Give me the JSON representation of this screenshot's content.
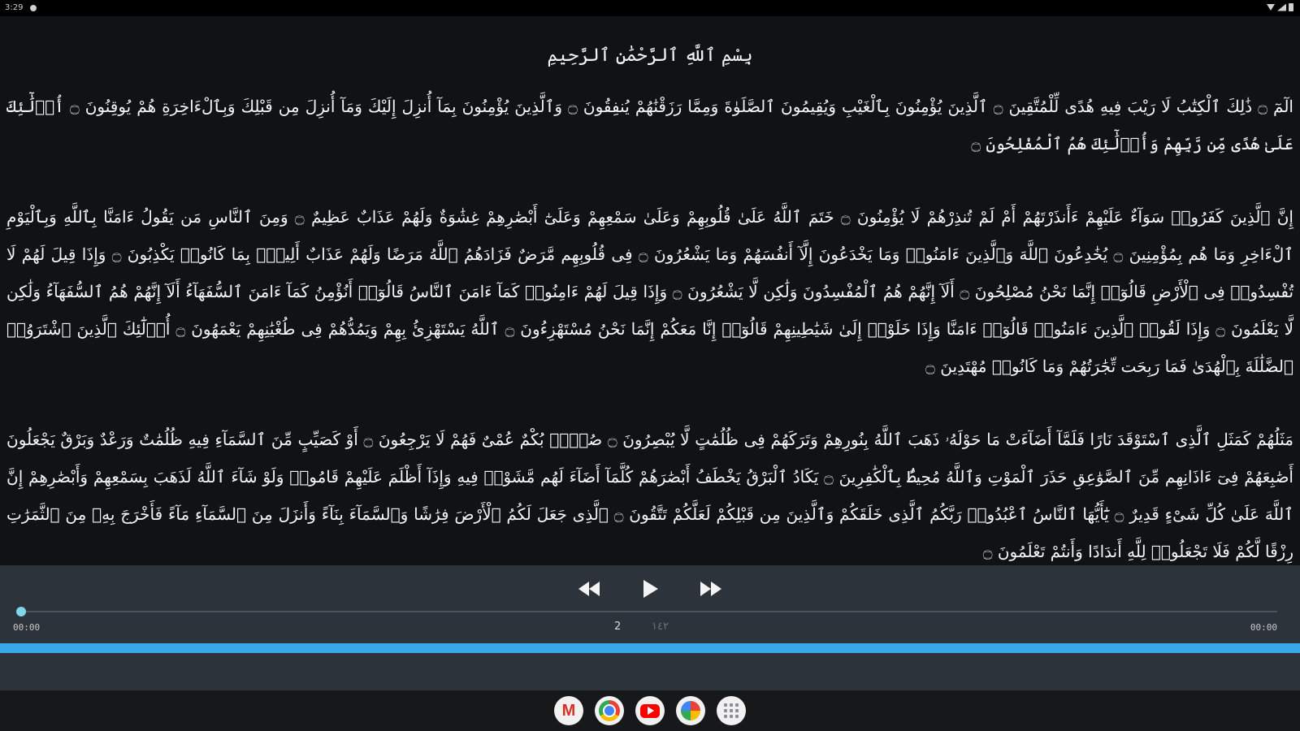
{
  "status_bar": {
    "time": "3:29"
  },
  "reader": {
    "bismillah": "بِسْمِ ٱللَّهِ ٱلرَّحْمَٰنِ ٱلرَّحِيمِ",
    "blocks": [
      "الٓمٓ ۝ ذَٰلِكَ ٱلْكِتَٰبُ لَا رَيْبَ فِيهِ هُدًى لِّلْمُتَّقِينَ ۝ ٱلَّذِينَ يُؤْمِنُونَ بِٱلْغَيْبِ وَيُقِيمُونَ ٱلصَّلَوٰةَ وَمِمَّا رَزَقْنَٰهُمْ يُنفِقُونَ ۝ وَٱلَّذِينَ يُؤْمِنُونَ بِمَآ أُنزِلَ إِلَيْكَ وَمَآ أُنزِلَ مِن قَبْلِكَ وَبِٱلْءَاخِرَةِ هُمْ يُوقِنُونَ ۝ أُو۟لَٰٓئِكَ عَلَىٰ هُدًى مِّن رَّبِّهِمْ وَأُو۟لَٰٓئِكَ هُمُ ٱلْمُفْلِحُونَ ۝",
      "إِنَّ ٱلَّذِينَ كَفَرُوا۟ سَوَآءٌ عَلَيْهِمْ ءَأَنذَرْتَهُمْ أَمْ لَمْ تُنذِرْهُمْ لَا يُؤْمِنُونَ ۝ خَتَمَ ٱللَّهُ عَلَىٰ قُلُوبِهِمْ وَعَلَىٰ سَمْعِهِمْ وَعَلَىٰٓ أَبْصَٰرِهِمْ غِشَٰوَةٌ وَلَهُمْ عَذَابٌ عَظِيمٌ ۝ وَمِنَ ٱلنَّاسِ مَن يَقُولُ ءَامَنَّا بِٱللَّهِ وَبِٱلْيَوْمِ ٱلْءَاخِرِ وَمَا هُم بِمُؤْمِنِينَ ۝ يُخَٰدِعُونَ ٱللَّهَ وَٱلَّذِينَ ءَامَنُوا۟ وَمَا يَخْدَعُونَ إِلَّآ أَنفُسَهُمْ وَمَا يَشْعُرُونَ ۝ فِى قُلُوبِهِم مَّرَضٌ فَزَادَهُمُ ٱللَّهُ مَرَضًا وَلَهُمْ عَذَابٌ أَلِيمٌۢ بِمَا كَانُوا۟ يَكْذِبُونَ ۝ وَإِذَا قِيلَ لَهُمْ لَا تُفْسِدُوا۟ فِى ٱلْأَرْضِ قَالُوٓا۟ إِنَّمَا نَحْنُ مُصْلِحُونَ ۝ أَلَآ إِنَّهُمْ هُمُ ٱلْمُفْسِدُونَ وَلَٰكِن لَّا يَشْعُرُونَ ۝ وَإِذَا قِيلَ لَهُمْ ءَامِنُوا۟ كَمَآ ءَامَنَ ٱلنَّاسُ قَالُوٓا۟ أَنُؤْمِنُ كَمَآ ءَامَنَ ٱلسُّفَهَآءُ أَلَآ إِنَّهُمْ هُمُ ٱلسُّفَهَآءُ وَلَٰكِن لَّا يَعْلَمُونَ ۝ وَإِذَا لَقُوا۟ ٱلَّذِينَ ءَامَنُوا۟ قَالُوٓا۟ ءَامَنَّا وَإِذَا خَلَوْا۟ إِلَىٰ شَيَٰطِينِهِمْ قَالُوٓا۟ إِنَّا مَعَكُمْ إِنَّمَا نَحْنُ مُسْتَهْزِءُونَ ۝ ٱللَّهُ يَسْتَهْزِئُ بِهِمْ وَيَمُدُّهُمْ فِى طُغْيَٰنِهِمْ يَعْمَهُونَ ۝ أُو۟لَٰٓئِكَ ٱلَّذِينَ ٱشْتَرَوُا۟ ٱلضَّلَٰلَةَ بِٱلْهُدَىٰ فَمَا رَبِحَت تِّجَٰرَتُهُمْ وَمَا كَانُوا۟ مُهْتَدِينَ ۝",
      "مَثَلُهُمْ كَمَثَلِ ٱلَّذِى ٱسْتَوْقَدَ نَارًا فَلَمَّآ أَضَآءَتْ مَا حَوْلَهُۥ ذَهَبَ ٱللَّهُ بِنُورِهِمْ وَتَرَكَهُمْ فِى ظُلُمَٰتٍ لَّا يُبْصِرُونَ ۝ صُمٌّۢ بُكْمٌ عُمْىٌ فَهُمْ لَا يَرْجِعُونَ ۝ أَوْ كَصَيِّبٍ مِّنَ ٱلسَّمَآءِ فِيهِ ظُلُمَٰتٌ وَرَعْدٌ وَبَرْقٌ يَجْعَلُونَ أَصَٰبِعَهُمْ فِىٓ ءَاذَانِهِم مِّنَ ٱلصَّوَٰعِقِ حَذَرَ ٱلْمَوْتِ وَٱللَّهُ مُحِيطٌۢ بِٱلْكَٰفِرِينَ ۝ يَكَادُ ٱلْبَرْقُ يَخْطَفُ أَبْصَٰرَهُمْ كُلَّمَآ أَضَآءَ لَهُم مَّشَوْا۟ فِيهِ وَإِذَآ أَظْلَمَ عَلَيْهِمْ قَامُوا۟ وَلَوْ شَآءَ ٱللَّهُ لَذَهَبَ بِسَمْعِهِمْ وَأَبْصَٰرِهِمْ إِنَّ ٱللَّهَ عَلَىٰ كُلِّ شَىْءٍ قَدِيرٌ ۝ يَٰٓأَيُّهَا ٱلنَّاسُ ٱعْبُدُوا۟ رَبَّكُمُ ٱلَّذِى خَلَقَكُمْ وَٱلَّذِينَ مِن قَبْلِكُمْ لَعَلَّكُمْ تَتَّقُونَ ۝ ٱلَّذِى جَعَلَ لَكُمُ ٱلْأَرْضَ فِرَٰشًا وَٱلسَّمَآءَ بِنَآءً وَأَنزَلَ مِنَ ٱلسَّمَآءِ مَآءً فَأَخْرَجَ بِهِۦ مِنَ ٱلثَّمَرَٰتِ رِزْقًا لَّكُمْ فَلَا تَجْعَلُوا۟ لِلَّهِ أَندَادًا وَأَنتُمْ تَعْلَمُونَ ۝"
    ]
  },
  "player": {
    "rewind_icon": "rewind-icon",
    "play_icon": "play-icon",
    "forward_icon": "fast-forward-icon",
    "progress": 0.0,
    "time_start": "00:00",
    "time_end": "00:00",
    "page_number": "2",
    "page_hint": "١٤٢"
  },
  "colors": {
    "background": "#111214",
    "player": "#2d333b",
    "accent": "#38a8e8",
    "seek": "#62c7d8"
  },
  "taskbar": {
    "apps": [
      "gmail-icon",
      "chrome-icon",
      "youtube-icon",
      "photos-icon",
      "app-drawer-icon"
    ]
  }
}
